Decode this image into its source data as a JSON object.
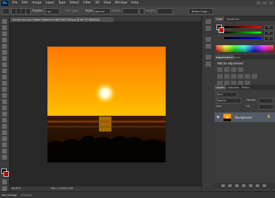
{
  "app": {
    "logo": "Ps"
  },
  "menu": [
    "File",
    "Edit",
    "Image",
    "Layer",
    "Type",
    "Select",
    "Filter",
    "3D",
    "View",
    "Window",
    "Help"
  ],
  "options": {
    "feather_label": "Feather:",
    "feather_value": "0 px",
    "anti_alias_label": "Anti-alias",
    "style_label": "Style:",
    "style_value": "Normal",
    "width_label": "Width:",
    "height_label": "Height:",
    "refine_edge_button": "Refine Edge..."
  },
  "document": {
    "tab_title": "sunrise-red-sea-Coltash-Sofbed-m148975437266.jpg @ 66.7% (RGB/8#)"
  },
  "status": {
    "zoom": "66.67%",
    "doc_size": "Doc: 1.22M/1.22M"
  },
  "bottom_tabs": [
    "Mini Bridge",
    "Timeline"
  ],
  "panels": {
    "color": {
      "tabs": [
        "Color",
        "Swatches"
      ],
      "values": {
        "r": "0",
        "g": "0",
        "b": "0"
      }
    },
    "adjustments": {
      "tabs": [
        "Adjustments",
        "Styles"
      ],
      "title": "Add an adjustment"
    },
    "layers": {
      "tabs": [
        "Layers",
        "Channels",
        "Paths"
      ],
      "kind_label": "Kind",
      "blend_mode": "Normal",
      "opacity_label": "Opacity:",
      "lock_label": "Lock:",
      "fill_label": "Fill:",
      "layer_name": "Background"
    }
  },
  "colors": {
    "accent_sun": "#fff8d0",
    "sky_top": "#ff7a00",
    "sky_horizon": "#ffd100"
  }
}
